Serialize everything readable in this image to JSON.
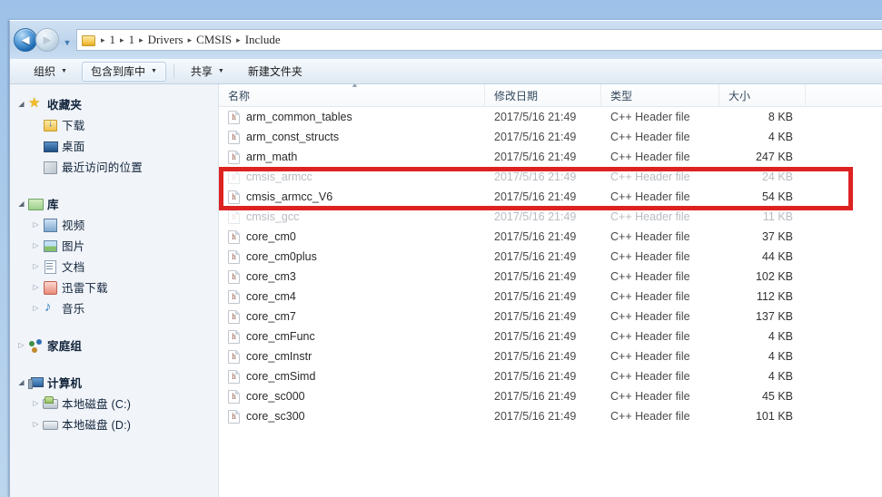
{
  "window": {
    "title": "Include"
  },
  "nav": {
    "back_label": "◄",
    "forward_label": "►",
    "history_label": "▼",
    "folder_icon": "folder-icon",
    "breadcrumbs": [
      "1",
      "1",
      "Drivers",
      "CMSIS",
      "Include"
    ],
    "separator": "▸"
  },
  "toolbar": {
    "organize": "组织",
    "include_in_library": "包含到库中",
    "share": "共享",
    "new_folder": "新建文件夹",
    "caret": "▼"
  },
  "sidebar": {
    "groups": [
      {
        "header": {
          "label": "收藏夹",
          "icon": "star-icon",
          "twisty": "◢"
        },
        "items": [
          {
            "label": "下载",
            "icon": "download-folder-icon",
            "twisty": ""
          },
          {
            "label": "桌面",
            "icon": "desktop-icon",
            "twisty": ""
          },
          {
            "label": "最近访问的位置",
            "icon": "recent-places-icon",
            "twisty": ""
          }
        ]
      },
      {
        "header": {
          "label": "库",
          "icon": "library-icon",
          "twisty": "◢"
        },
        "items": [
          {
            "label": "视频",
            "icon": "video-icon",
            "twisty": "▷"
          },
          {
            "label": "图片",
            "icon": "pictures-icon",
            "twisty": "▷"
          },
          {
            "label": "文档",
            "icon": "documents-icon",
            "twisty": "▷"
          },
          {
            "label": "迅雷下载",
            "icon": "xunlei-download-icon",
            "twisty": "▷"
          },
          {
            "label": "音乐",
            "icon": "music-icon",
            "twisty": "▷"
          }
        ]
      },
      {
        "header": {
          "label": "家庭组",
          "icon": "homegroup-icon",
          "twisty": "▷"
        },
        "items": []
      },
      {
        "header": {
          "label": "计算机",
          "icon": "computer-icon",
          "twisty": "◢"
        },
        "items": [
          {
            "label": "本地磁盘 (C:)",
            "icon": "drive-c-icon",
            "twisty": "▷"
          },
          {
            "label": "本地磁盘 (D:)",
            "icon": "drive-d-icon",
            "twisty": "▷"
          }
        ]
      }
    ]
  },
  "filelist": {
    "columns": [
      "名称",
      "修改日期",
      "类型",
      "大小"
    ],
    "sort_indicator": "▲",
    "rows": [
      {
        "name": "arm_common_tables",
        "date": "2017/5/16 21:49",
        "type": "C++ Header file",
        "size": "8 KB",
        "icon": "h-header-file-icon",
        "obscured": false
      },
      {
        "name": "arm_const_structs",
        "date": "2017/5/16 21:49",
        "type": "C++ Header file",
        "size": "4 KB",
        "icon": "h-header-file-icon",
        "obscured": false
      },
      {
        "name": "arm_math",
        "date": "2017/5/16 21:49",
        "type": "C++ Header file",
        "size": "247 KB",
        "icon": "h-header-file-icon",
        "obscured": false
      },
      {
        "name": "cmsis_armcc",
        "date": "2017/5/16 21:49",
        "type": "C++ Header file",
        "size": "24 KB",
        "icon": "h-header-file-icon",
        "obscured": true
      },
      {
        "name": "cmsis_armcc_V6",
        "date": "2017/5/16 21:49",
        "type": "C++ Header file",
        "size": "54 KB",
        "icon": "h-header-file-icon",
        "obscured": false
      },
      {
        "name": "cmsis_gcc",
        "date": "2017/5/16 21:49",
        "type": "C++ Header file",
        "size": "11 KB",
        "icon": "h-header-file-icon",
        "obscured": true
      },
      {
        "name": "core_cm0",
        "date": "2017/5/16 21:49",
        "type": "C++ Header file",
        "size": "37 KB",
        "icon": "h-header-file-icon",
        "obscured": false
      },
      {
        "name": "core_cm0plus",
        "date": "2017/5/16 21:49",
        "type": "C++ Header file",
        "size": "44 KB",
        "icon": "h-header-file-icon",
        "obscured": false
      },
      {
        "name": "core_cm3",
        "date": "2017/5/16 21:49",
        "type": "C++ Header file",
        "size": "102 KB",
        "icon": "h-header-file-icon",
        "obscured": false
      },
      {
        "name": "core_cm4",
        "date": "2017/5/16 21:49",
        "type": "C++ Header file",
        "size": "112 KB",
        "icon": "h-header-file-icon",
        "obscured": false
      },
      {
        "name": "core_cm7",
        "date": "2017/5/16 21:49",
        "type": "C++ Header file",
        "size": "137 KB",
        "icon": "h-header-file-icon",
        "obscured": false
      },
      {
        "name": "core_cmFunc",
        "date": "2017/5/16 21:49",
        "type": "C++ Header file",
        "size": "4 KB",
        "icon": "h-header-file-icon",
        "obscured": false
      },
      {
        "name": "core_cmInstr",
        "date": "2017/5/16 21:49",
        "type": "C++ Header file",
        "size": "4 KB",
        "icon": "h-header-file-icon",
        "obscured": false
      },
      {
        "name": "core_cmSimd",
        "date": "2017/5/16 21:49",
        "type": "C++ Header file",
        "size": "4 KB",
        "icon": "h-header-file-icon",
        "obscured": false
      },
      {
        "name": "core_sc000",
        "date": "2017/5/16 21:49",
        "type": "C++ Header file",
        "size": "45 KB",
        "icon": "h-header-file-icon",
        "obscured": false
      },
      {
        "name": "core_sc300",
        "date": "2017/5/16 21:49",
        "type": "C++ Header file",
        "size": "101 KB",
        "icon": "h-header-file-icon",
        "obscured": false
      }
    ]
  },
  "annotation": {
    "type": "red-rectangle-highlight",
    "color": "#dd2222",
    "highlights_row": "cmsis_armcc_V6"
  }
}
